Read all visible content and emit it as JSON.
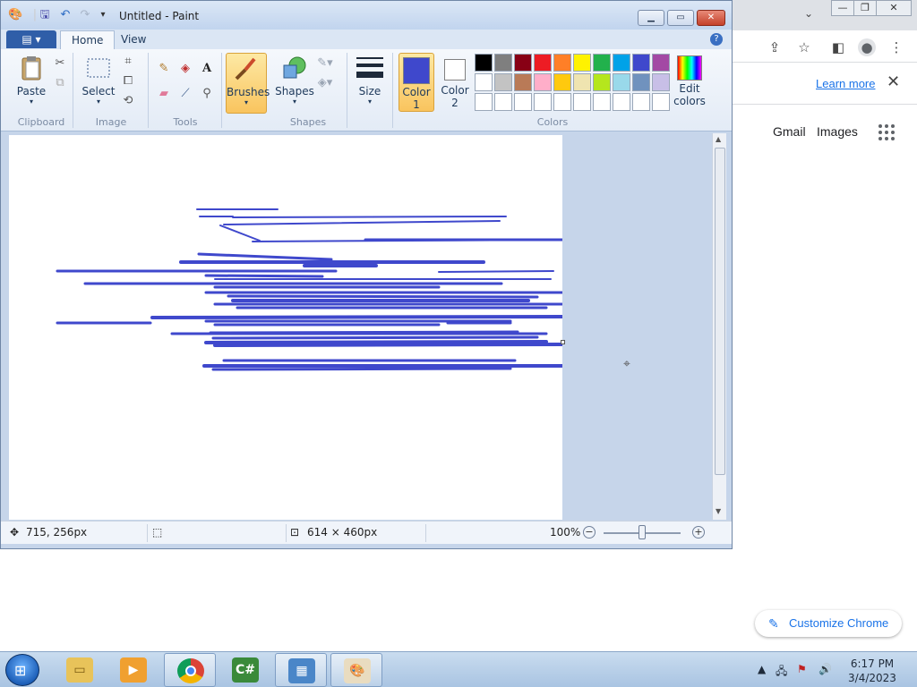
{
  "paint": {
    "title": "Untitled - Paint",
    "tabs": [
      "Home",
      "View"
    ],
    "groups": {
      "clipboard": {
        "label": "Clipboard",
        "paste": "Paste"
      },
      "image": {
        "label": "Image",
        "select": "Select"
      },
      "tools": {
        "label": "Tools"
      },
      "brushes": {
        "label": "Brushes"
      },
      "shapes": {
        "label": "Shapes",
        "button": "Shapes"
      },
      "size": {
        "label": "Size"
      },
      "colors": {
        "label": "Colors",
        "color1_line1": "Color",
        "color1_line2": "1",
        "color2_line1": "Color",
        "color2_line2": "2",
        "edit_line1": "Edit",
        "edit_line2": "colors"
      }
    },
    "color1": "#3f48cc",
    "color2": "#ffffff",
    "palette": [
      "#000000",
      "#7f7f7f",
      "#880015",
      "#ed1c24",
      "#ff7f27",
      "#fff200",
      "#22b14c",
      "#00a2e8",
      "#3f48cc",
      "#a349a4",
      "#ffffff",
      "#c3c3c3",
      "#b97a57",
      "#ffaec9",
      "#ffc90e",
      "#efe4b0",
      "#b5e61d",
      "#99d9ea",
      "#7092be",
      "#c8bfe7",
      "#ffffff",
      "#ffffff",
      "#ffffff",
      "#ffffff",
      "#ffffff",
      "#ffffff",
      "#ffffff",
      "#ffffff",
      "#ffffff",
      "#ffffff"
    ],
    "status": {
      "cursor": "715, 256px",
      "size": "614 × 460px",
      "zoom": "100%"
    },
    "stroke_color": "#3f48cc"
  },
  "chrome": {
    "learn_more": "Learn more",
    "gmail": "Gmail",
    "images": "Images",
    "customize": "Customize Chrome"
  },
  "taskbar": {
    "time": "6:17 PM",
    "date": "3/4/2023"
  }
}
